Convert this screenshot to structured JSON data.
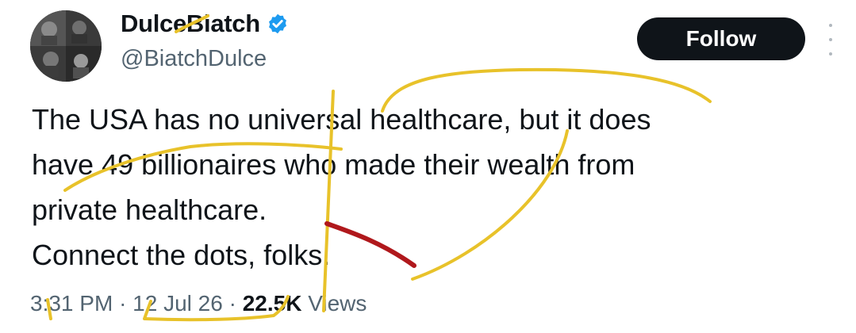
{
  "author": {
    "display_name": "DulceBiatch",
    "handle": "@BiatchDulce",
    "verified": true,
    "avatar_icon": "profile-photo"
  },
  "actions": {
    "follow_label": "Follow",
    "more_icon": "more-vertical-icon"
  },
  "tweet": {
    "lines": [
      "The USA has no universal healthcare, but it does",
      "have 49 billionaires who made their wealth from",
      "private healthcare.",
      "Connect the dots, folks."
    ]
  },
  "meta": {
    "time": "3:31 PM",
    "separator": "·",
    "date": "12 Jul 26",
    "views_count": "22.5K",
    "views_label": "Views"
  },
  "colors": {
    "primary_text": "#0f1419",
    "secondary_text": "#536471",
    "verified_blue": "#1d9bf0",
    "follow_button_bg": "#0f1419",
    "annotation_yellow": "#e8c22a",
    "annotation_red": "#b0181c"
  }
}
